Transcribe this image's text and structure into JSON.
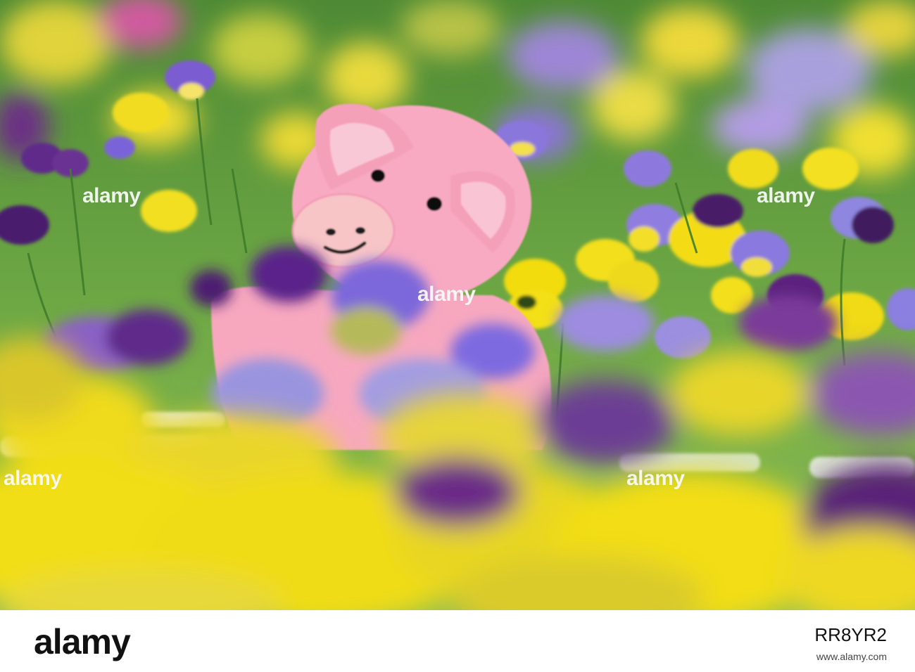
{
  "photo": {
    "subject": "",
    "watermark": "alamy"
  },
  "footer": {
    "logo": "alamy",
    "image_id": "RR8YR2",
    "line": "www.alamy.com"
  },
  "colors": {
    "pink": "#f7a9c0",
    "yellow": "#f2e10b",
    "purple": "#5b2c86",
    "violet": "#7b63d9",
    "green": "#5c9a3a"
  }
}
